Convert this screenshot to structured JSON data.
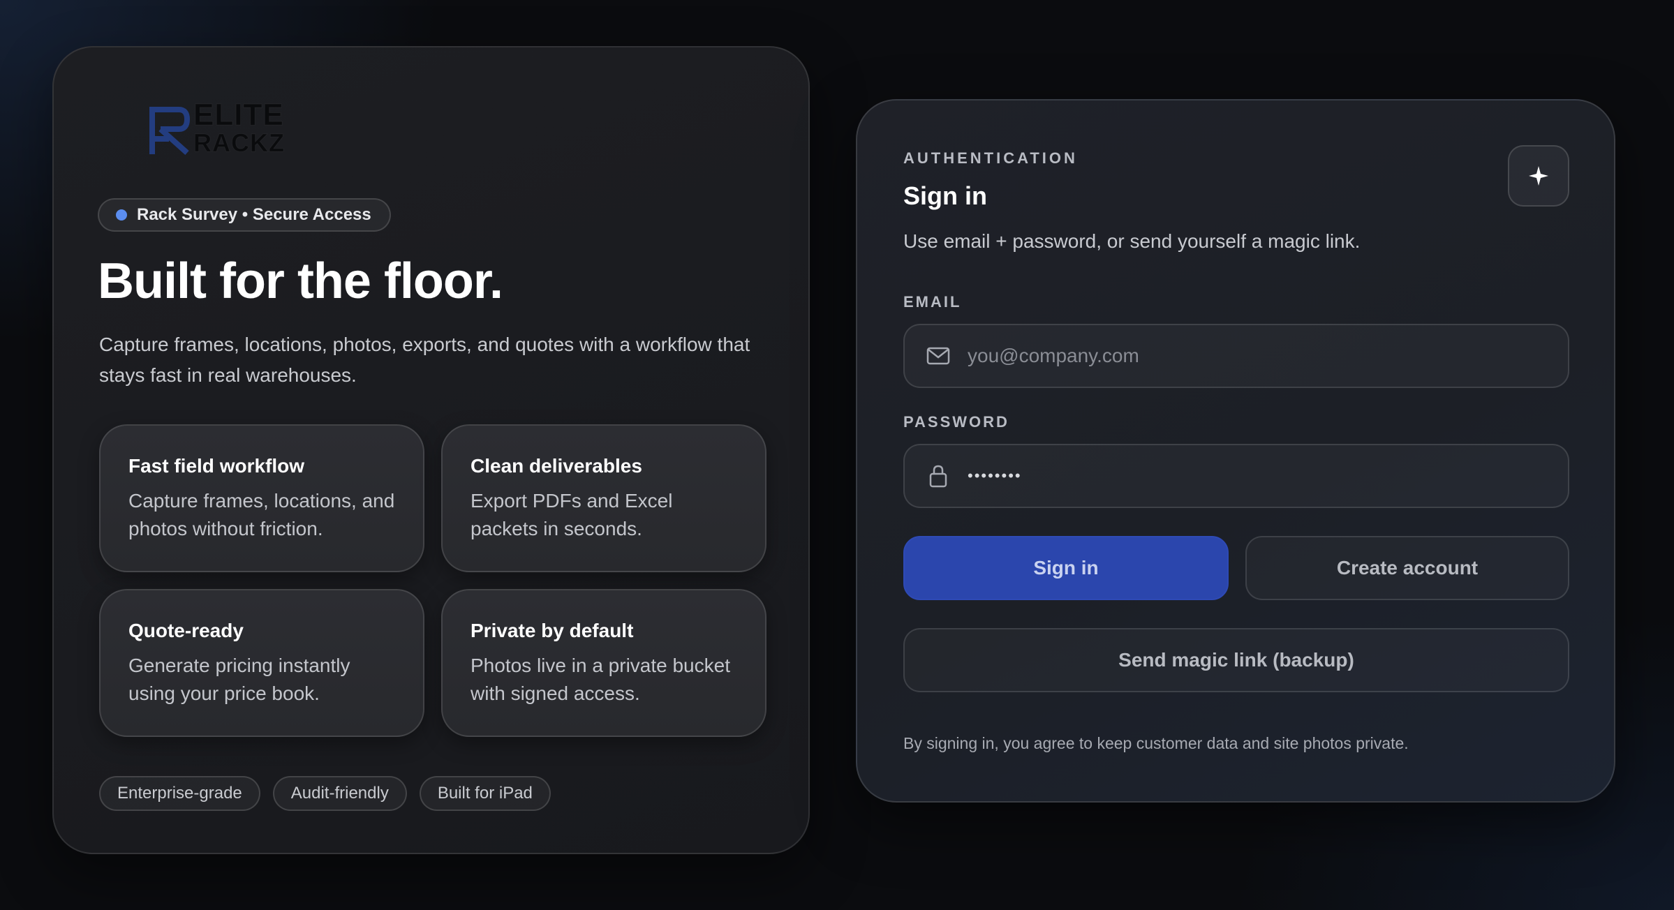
{
  "brand": {
    "logo_line1": "ELITE",
    "logo_line2": "RACKZ",
    "logo_color": "#233d80"
  },
  "hero": {
    "pill_label": "Rack Survey • Secure Access",
    "pill_dot_color": "#5b8def",
    "title": "Built for the floor.",
    "description": "Capture frames, locations, photos, exports, and quotes with a workflow that stays fast in real warehouses.",
    "features": [
      {
        "title": "Fast field workflow",
        "description": "Capture frames, locations, and photos without friction."
      },
      {
        "title": "Clean deliverables",
        "description": "Export PDFs and Excel packets in seconds."
      },
      {
        "title": "Quote-ready",
        "description": "Generate pricing instantly using your price book."
      },
      {
        "title": "Private by default",
        "description": "Photos live in a private bucket with signed access."
      }
    ],
    "tags": [
      "Enterprise-grade",
      "Audit-friendly",
      "Built for iPad"
    ]
  },
  "auth": {
    "eyebrow": "AUTHENTICATION",
    "title": "Sign in",
    "subtitle": "Use email + password, or send yourself a magic link.",
    "sparkle_icon": "sparkle-icon",
    "email": {
      "label": "EMAIL",
      "placeholder": "you@company.com",
      "value": "",
      "icon": "mail-icon"
    },
    "password": {
      "label": "PASSWORD",
      "value": "••••••••",
      "icon": "lock-icon"
    },
    "sign_in_label": "Sign in",
    "create_account_label": "Create account",
    "magic_link_label": "Send magic link (backup)",
    "footnote": "By signing in, you agree to keep customer data and site photos private.",
    "primary_color": "#2b46ad"
  }
}
